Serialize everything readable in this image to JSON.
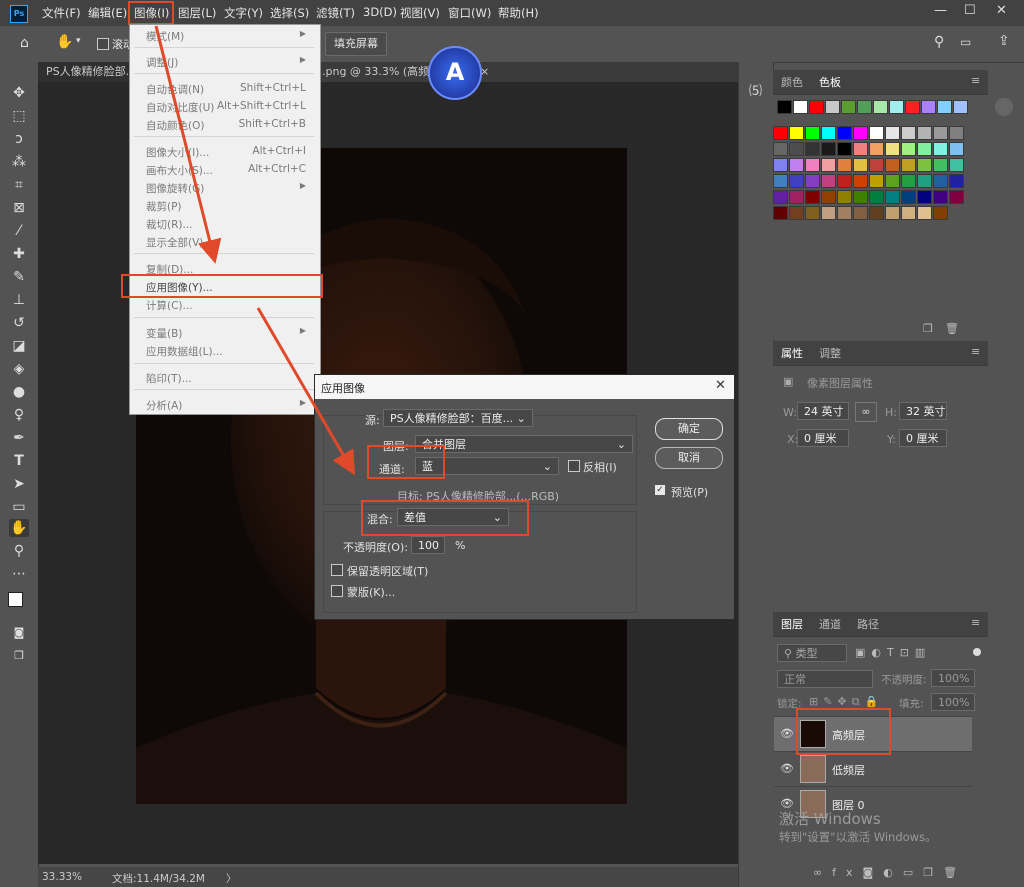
{
  "menubar": {
    "logo": "Ps",
    "items": [
      "文件(F)",
      "编辑(E)",
      "图像(I)",
      "图层(L)",
      "文字(Y)",
      "选择(S)",
      "滤镜(T)",
      "3D(D)",
      "视图(V)",
      "窗口(W)",
      "帮助(H)"
    ],
    "controls": [
      "—",
      "☐",
      "✕"
    ]
  },
  "options": {
    "scroll_label": "滚动",
    "fill_screen": "填充屏幕"
  },
  "tabs": {
    "doc1": "PS人像精修脸部...",
    "doc2": ".png @ 33.3% (高频层...",
    "close": "×"
  },
  "image_menu": {
    "items": [
      {
        "label": "模式(M)",
        "shortcut": "",
        "arrow": "▶"
      },
      {
        "label": "调整(J)",
        "shortcut": "",
        "arrow": "▶"
      },
      {
        "label": "自动色调(N)",
        "shortcut": "Shift+Ctrl+L",
        "arrow": ""
      },
      {
        "label": "自动对比度(U)",
        "shortcut": "Alt+Shift+Ctrl+L",
        "arrow": ""
      },
      {
        "label": "自动颜色(O)",
        "shortcut": "Shift+Ctrl+B",
        "arrow": ""
      },
      {
        "label": "图像大小(I)...",
        "shortcut": "Alt+Ctrl+I",
        "arrow": ""
      },
      {
        "label": "画布大小(S)...",
        "shortcut": "Alt+Ctrl+C",
        "arrow": ""
      },
      {
        "label": "图像旋转(G)",
        "shortcut": "",
        "arrow": "▶"
      },
      {
        "label": "裁剪(P)",
        "shortcut": "",
        "arrow": ""
      },
      {
        "label": "裁切(R)...",
        "shortcut": "",
        "arrow": ""
      },
      {
        "label": "显示全部(V)",
        "shortcut": "",
        "arrow": ""
      },
      {
        "label": "复制(D)...",
        "shortcut": "",
        "arrow": ""
      },
      {
        "label": "应用图像(Y)...",
        "shortcut": "",
        "arrow": ""
      },
      {
        "label": "计算(C)...",
        "shortcut": "",
        "arrow": ""
      },
      {
        "label": "变量(B)",
        "shortcut": "",
        "arrow": "▶"
      },
      {
        "label": "应用数据组(L)...",
        "shortcut": "",
        "arrow": ""
      },
      {
        "label": "陷印(T)...",
        "shortcut": "",
        "arrow": ""
      },
      {
        "label": "分析(A)",
        "shortcut": "",
        "arrow": "▶"
      }
    ]
  },
  "dialog": {
    "title": "应用图像",
    "source_label": "源:",
    "source_value": "PS人像精修脸部：百度...",
    "layer_label": "图层:",
    "layer_value": "合并图层",
    "channel_label": "通道:",
    "channel_value": "蓝",
    "invert_label": "反相(I)",
    "target_text": "目标:   PS人像精修脸部...(...RGB)",
    "blend_label": "混合:",
    "blend_value": "差值",
    "opacity_label": "不透明度(O):",
    "opacity_value": "100",
    "opacity_unit": "%",
    "preserve_label": "保留透明区域(T)",
    "mask_label": "蒙版(K)...",
    "ok": "确定",
    "cancel": "取消",
    "preview_label": "预览(P)",
    "preview_checked": true
  },
  "color_panel": {
    "tab_color": "颜色",
    "tab_swatches": "色板"
  },
  "properties": {
    "tab_props": "属性",
    "tab_adjust": "调整",
    "subtitle": "像素图层属性",
    "w_label": "W:",
    "w_value": "24 英寸",
    "h_label": "H:",
    "h_value": "32 英寸",
    "x_label": "X:",
    "x_value": "0 厘米",
    "y_label": "Y:",
    "y_value": "0 厘米"
  },
  "layers": {
    "tab_layers": "图层",
    "tab_channels": "通道",
    "tab_paths": "路径",
    "filter_label": "类型",
    "blend_mode": "正常",
    "opacity_label": "不透明度:",
    "opacity_value": "100%",
    "lock_label": "锁定:",
    "fill_label": "填充:",
    "fill_value": "100%",
    "items": [
      {
        "name": "高频层",
        "selected": true
      },
      {
        "name": "低频层",
        "selected": false
      },
      {
        "name": "图层 0",
        "selected": false
      }
    ]
  },
  "status": {
    "zoom": "33.33%",
    "doc": "文档:11.4M/34.2M",
    "arrow": "〉"
  },
  "watermark": {
    "line1": "激活 Windows",
    "line2": "转到\"设置\"以激活 Windows。"
  },
  "colors": {
    "highlight": "#e04a2a",
    "panel_bg": "#535353",
    "menu_bg": "#f0f0f0"
  }
}
